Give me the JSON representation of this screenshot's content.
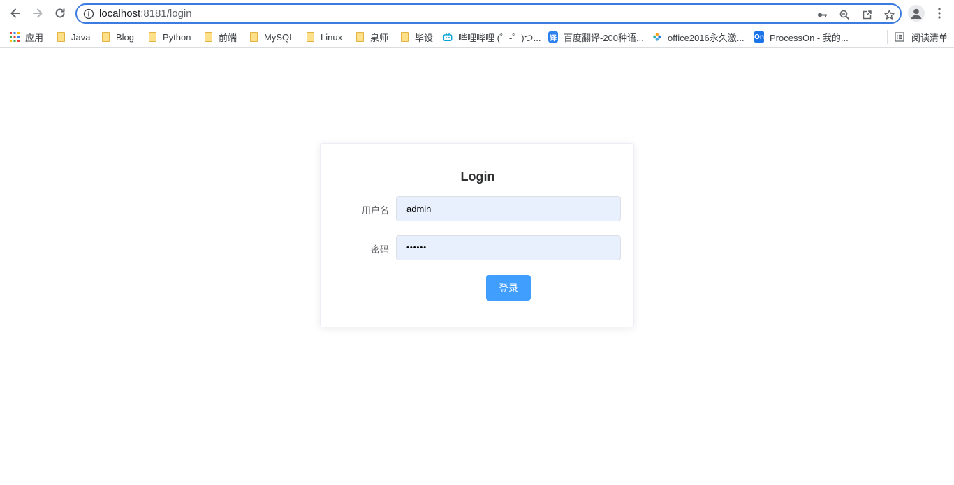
{
  "browser": {
    "url_host": "localhost",
    "url_rest": ":8181/login"
  },
  "bookmarks": {
    "apps_label": "应用",
    "items": [
      {
        "label": "Java",
        "icon": "folder-icon"
      },
      {
        "label": "Blog",
        "icon": "folder-icon"
      },
      {
        "label": "Python",
        "icon": "folder-icon"
      },
      {
        "label": "前端",
        "icon": "folder-icon"
      },
      {
        "label": "MySQL",
        "icon": "folder-icon"
      },
      {
        "label": "Linux",
        "icon": "folder-icon"
      },
      {
        "label": "泉师",
        "icon": "folder-icon"
      },
      {
        "label": "毕设",
        "icon": "folder-icon"
      },
      {
        "label": "哔哩哔哩 (゜-゜)つ...",
        "icon": "bilibili-icon"
      },
      {
        "label": "百度翻译-200种语...",
        "icon": "baidu-translate-icon",
        "icon_text": "译"
      },
      {
        "label": "office2016永久激...",
        "icon": "office-diamond-icon"
      },
      {
        "label": "ProcessOn - 我的...",
        "icon": "processon-icon",
        "icon_text": "On"
      }
    ],
    "reading_list_label": "阅读清单"
  },
  "login": {
    "title": "Login",
    "username_label": "用户名",
    "username_value": "admin",
    "password_label": "密码",
    "password_value": "••••••",
    "submit_label": "登录"
  },
  "colors": {
    "primary": "#409eff",
    "omnibox_border": "#3c7be0",
    "autofill_background": "#e8f0fe"
  }
}
